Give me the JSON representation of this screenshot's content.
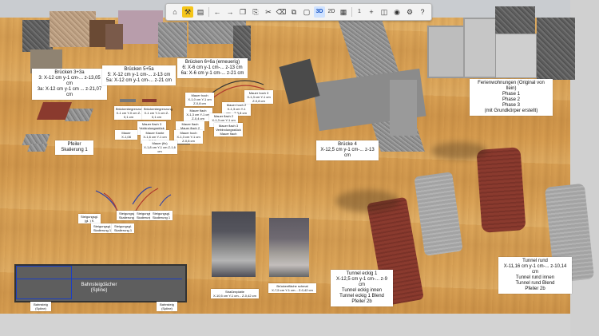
{
  "toolbar": {
    "icons": [
      "home-icon",
      "tools-icon",
      "save-icon",
      "undo-icon",
      "redo-icon",
      "copy-icon",
      "paste-icon",
      "cut-icon",
      "delete-icon",
      "duplicate-icon",
      "group-icon",
      "view-3d",
      "view-2d",
      "grid-icon",
      "layer-number",
      "add-icon",
      "layers-icon",
      "camera-icon",
      "settings-icon",
      "help-icon"
    ],
    "view_3d": "3D",
    "view_2d": "2D",
    "layer_value": "1",
    "help": "?"
  },
  "labels": {
    "bruecken_3": [
      "Brücken 3+3a",
      "3: X-12 cm y-1 cm-... z-13,05 cm",
      "3a: X-12 cm y-1 cm ... z-21,07 cm"
    ],
    "bruecken_5": [
      "Brücken 5+5a",
      "5: X-12 cm y-1 cm-... z-13 cm",
      "5a: X-12 cm y-1 cm-... z-21 cm"
    ],
    "bruecken_6": [
      "Brücken 6+6a (erneuerig)",
      "6: X-6 cm y-1 cm-... z-13 cm",
      "6a: X-6 cm y-1 cm-... z-21 cm"
    ],
    "ferien": [
      "Ferienwohnungen (Original von Ilein)",
      "Phase 1",
      "Phase 2",
      "Phase 3",
      "(mit Grundkörper erstellt)"
    ],
    "pfeiler": [
      "Pfeiler",
      "Skalierung 1"
    ],
    "bruecke_4": [
      "Brücke 4",
      "X-12,5 cm y-1 cm-... z-13 cm"
    ],
    "tunnel_eckig": [
      "Tunnel eckig 1",
      "X-12,5 cm y-1 cm-... z-9 cm",
      "Tunnel eckig innen",
      "Tunnel eckig 1 Blend",
      "Pfeiler 2b"
    ],
    "tunnel_rund": [
      "Tunnel rund",
      "X-11,16 cm y-1 cm-... z-10,14 cm",
      "Tunnel rund innen",
      "Tunnel rund Blend",
      "Pfeiler 2b"
    ],
    "bahnsteig": [
      "Bahnsteigdächer",
      "(Spline)"
    ],
    "strassenplatte": [
      "Straßenplatte",
      "X-10,5 cm Y-1 cm... Z-0,42 cm"
    ],
    "bruecke_flaeche": [
      "Brückenfläche schmal",
      "X-7,5 cm Y-1 cm... Z-0,42 cm"
    ],
    "small_a": [
      "Brückenbegrenzung",
      "X-1 cm Y-0 cm Z-0,1 cm"
    ],
    "small_b": [
      "Brückenbegrenzung",
      "X-1 cm Y-1 cm Z-0,1 cm"
    ],
    "small_c": [
      "Mauer hoch",
      "X-1,0 cm Y-1 cm Z-0,8 cm"
    ],
    "small_d": [
      "Mauer hoch 2",
      "X-1,3 cm Y-1 cm... Z-0,8 cm"
    ],
    "small_e": [
      "Mauer hoch 3",
      "X-1,3 cm Y-1 cm Z-0,8 cm"
    ],
    "small_f": [
      "Mauer flach",
      "X-1,3 cm Y-1 cm Z-0,4 cm"
    ],
    "small_g": [
      "Mauer flach 2",
      "X-1,3 cm Y-1 cm Z-0,4 cm"
    ],
    "small_h": [
      "Mauer flach 3",
      "Verbindungsstück Mauer flach"
    ],
    "small_i": [
      "Mauer flach",
      "Mauer flach 2"
    ],
    "small_j": [
      "Mauer flach 3",
      "Verbindungsstück Mauer flach"
    ],
    "small_k": [
      "Mauer Kante",
      "X-1,6 cm Y-1 cm Z-0,5 cm"
    ],
    "small_l": [
      "Mauer hoch",
      "X-1,3 cm Y-1 cm Z-0,8 cm"
    ],
    "small_m": [
      "Mauer (fix)",
      "X-1,8 cm Y-1 cm Z-1,6 cm"
    ],
    "small_n": [
      "Mauer",
      "X-1,08"
    ],
    "small_o": [
      "Steigungsgl.",
      "(gl. ) fl."
    ],
    "small_p": [
      "Steigungsgl.",
      "Skalierung 1"
    ],
    "small_q": [
      "Steigungsgl.",
      "Skalierung 1"
    ],
    "small_r": [
      "Steigungsgl.",
      "Skalierung 1"
    ],
    "small_s": [
      "Steigungsgl.",
      "Skalierung 1"
    ],
    "small_t": [
      "Steigungsgl.",
      "Skalierung 1"
    ],
    "small_u": [
      "Bahnsteig",
      "(Spline)"
    ],
    "small_v": [
      "Bahnsteig",
      "(Spline)"
    ]
  },
  "colors": {
    "accent": "#f5c518",
    "selected": "#1a56c4",
    "brick": "#8a3a2e",
    "wood": "#d69c4f"
  }
}
